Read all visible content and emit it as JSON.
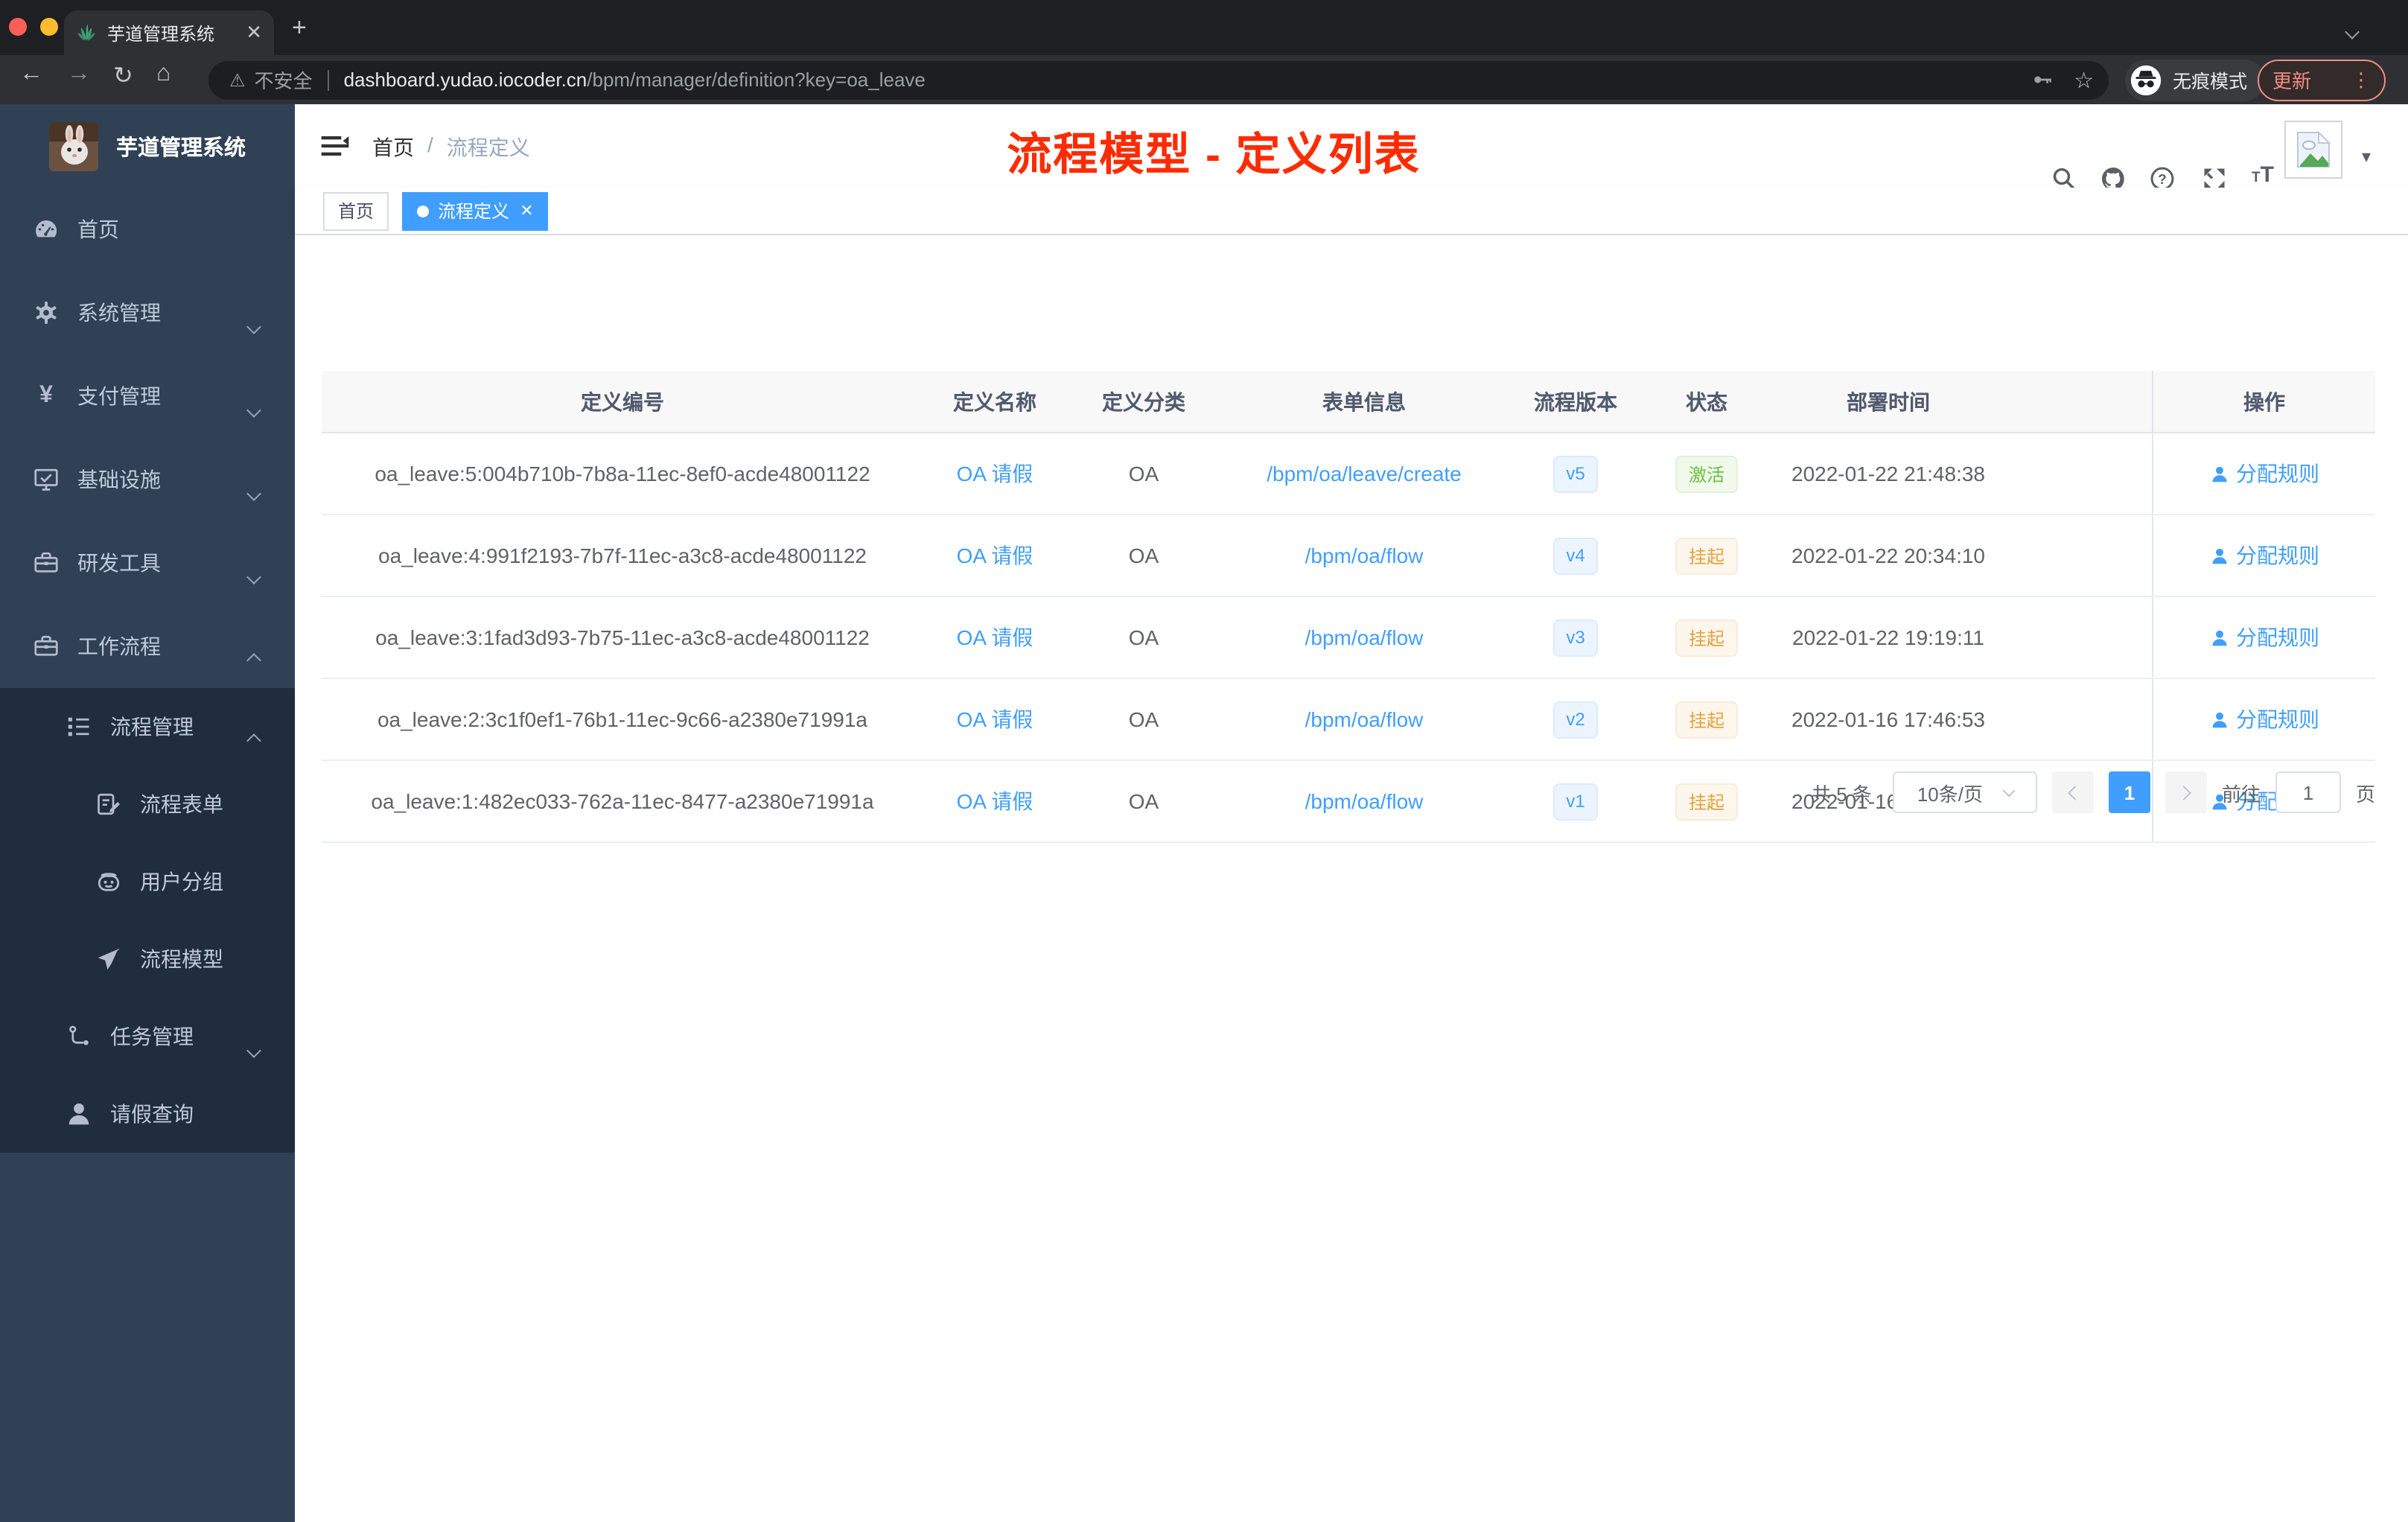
{
  "browser": {
    "tab_title": "芋道管理系统",
    "security_label": "不安全",
    "url_host": "dashboard.yudao.iocoder.cn",
    "url_path": "/bpm/manager/definition?key=oa_leave",
    "incognito_label": "无痕模式",
    "update_label": "更新"
  },
  "annotation": {
    "title": "流程模型 - 定义列表",
    "color": "#fe2b00"
  },
  "sidebar": {
    "app_title": "芋道管理系统",
    "items": [
      {
        "name": "home",
        "label": "首页",
        "icon": "dashboard",
        "level": 1,
        "chevron": null
      },
      {
        "name": "system-management",
        "label": "系统管理",
        "icon": "gear",
        "level": 1,
        "chevron": "down"
      },
      {
        "name": "payment-management",
        "label": "支付管理",
        "icon": "yen",
        "level": 1,
        "chevron": "down"
      },
      {
        "name": "infrastructure",
        "label": "基础设施",
        "icon": "monitor",
        "level": 1,
        "chevron": "down"
      },
      {
        "name": "dev-tools",
        "label": "研发工具",
        "icon": "toolbox",
        "level": 1,
        "chevron": "down"
      },
      {
        "name": "workflow",
        "label": "工作流程",
        "icon": "toolbox",
        "level": 1,
        "chevron": "up"
      },
      {
        "name": "process-management",
        "label": "流程管理",
        "icon": "tree-list",
        "level": 2,
        "chevron": "up"
      },
      {
        "name": "process-form",
        "label": "流程表单",
        "icon": "form",
        "level": 3,
        "chevron": null
      },
      {
        "name": "user-group",
        "label": "用户分组",
        "icon": "people",
        "level": 3,
        "chevron": null
      },
      {
        "name": "process-model",
        "label": "流程模型",
        "icon": "send",
        "level": 3,
        "chevron": null
      },
      {
        "name": "task-management",
        "label": "任务管理",
        "icon": "tree",
        "level": 2,
        "chevron": "down"
      },
      {
        "name": "leave-query",
        "label": "请假查询",
        "icon": "user",
        "level": 2,
        "chevron": null
      }
    ]
  },
  "header": {
    "breadcrumb_home": "首页",
    "breadcrumb_separator": "/",
    "breadcrumb_current": "流程定义"
  },
  "tags": [
    {
      "label": "首页",
      "active": false
    },
    {
      "label": "流程定义",
      "active": true
    }
  ],
  "table": {
    "columns": {
      "id": "定义编号",
      "name": "定义名称",
      "category": "定义分类",
      "form": "表单信息",
      "version": "流程版本",
      "status": "状态",
      "time": "部署时间",
      "action": "操作"
    },
    "rows": [
      {
        "id": "oa_leave:5:004b710b-7b8a-11ec-8ef0-acde48001122",
        "name": "OA 请假",
        "category": "OA",
        "form": "/bpm/oa/leave/create",
        "version": "v5",
        "status": "激活",
        "status_type": "success",
        "time": "2022-01-22 21:48:38",
        "action": "分配规则"
      },
      {
        "id": "oa_leave:4:991f2193-7b7f-11ec-a3c8-acde48001122",
        "name": "OA 请假",
        "category": "OA",
        "form": "/bpm/oa/flow",
        "version": "v4",
        "status": "挂起",
        "status_type": "warning",
        "time": "2022-01-22 20:34:10",
        "action": "分配规则"
      },
      {
        "id": "oa_leave:3:1fad3d93-7b75-11ec-a3c8-acde48001122",
        "name": "OA 请假",
        "category": "OA",
        "form": "/bpm/oa/flow",
        "version": "v3",
        "status": "挂起",
        "status_type": "warning",
        "time": "2022-01-22 19:19:11",
        "action": "分配规则"
      },
      {
        "id": "oa_leave:2:3c1f0ef1-76b1-11ec-9c66-a2380e71991a",
        "name": "OA 请假",
        "category": "OA",
        "form": "/bpm/oa/flow",
        "version": "v2",
        "status": "挂起",
        "status_type": "warning",
        "time": "2022-01-16 17:46:53",
        "action": "分配规则"
      },
      {
        "id": "oa_leave:1:482ec033-762a-11ec-8477-a2380e71991a",
        "name": "OA 请假",
        "category": "OA",
        "form": "/bpm/oa/flow",
        "version": "v1",
        "status": "挂起",
        "status_type": "warning",
        "time": "2022-01-16 01:40:51",
        "action": "分配规则"
      }
    ]
  },
  "pagination": {
    "total_label": "共 5 条",
    "page_size_label": "10条/页",
    "current_page": "1",
    "goto_label": "前往",
    "goto_value": "1",
    "page_unit": "页"
  }
}
